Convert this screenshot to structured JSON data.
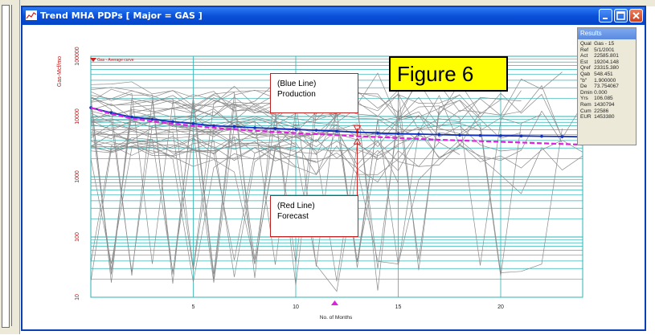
{
  "window": {
    "title": "Trend MHA PDPs  [ Major = GAS ]"
  },
  "annotations": {
    "figure_label": "Figure 6",
    "blue_callout": {
      "line1": "(Blue Line)",
      "line2": "Production"
    },
    "red_callout": {
      "line1": "(Red Line)",
      "line2": "Forecast"
    }
  },
  "results": {
    "title": "Results",
    "rows": [
      {
        "key": "Qual",
        "value": "Gas - 15"
      },
      {
        "key": "Ref",
        "value": "5/1/2001"
      },
      {
        "key": "Act",
        "value": "22585.801"
      },
      {
        "key": "Est",
        "value": "19204.148"
      },
      {
        "key": "Qref",
        "value": "23315.380"
      },
      {
        "key": "Qab",
        "value": "548.451"
      },
      {
        "key": "\"b\"",
        "value": "1.900000"
      },
      {
        "key": "De",
        "value": "73.754067"
      },
      {
        "key": "Dmin",
        "value": "0.000"
      },
      {
        "key": "Yrs",
        "value": "106.085"
      },
      {
        "key": "Rem",
        "value": "1430794"
      },
      {
        "key": "Cum",
        "value": "22586"
      },
      {
        "key": "EUR",
        "value": "1453380"
      }
    ]
  },
  "colors": {
    "grid": "#2bb3b3",
    "production": "#1030c0",
    "forecast": "#e020e0",
    "wells": "#8a8a8a",
    "axis_text": "#c01010"
  },
  "chart_data": {
    "type": "line",
    "ylabel": "Gas-Mcf/mo",
    "xlabel": "No. of Months",
    "legend": "Gas - Average curve",
    "y_scale": "log",
    "ylim": [
      10,
      100000
    ],
    "xlim": [
      0,
      24
    ],
    "y_ticks": [
      "100000",
      "10000",
      "1000",
      "100",
      "10"
    ],
    "x_ticks": [
      "5",
      "10",
      "15",
      "20"
    ],
    "grid": true,
    "series": [
      {
        "name": "Production",
        "x": [
          0,
          1,
          2,
          3,
          4,
          5,
          6,
          7,
          8,
          9,
          10,
          11,
          12,
          13,
          14,
          15,
          16,
          17,
          18,
          19,
          20,
          21,
          22,
          23,
          24
        ],
        "values": [
          14000,
          11500,
          9800,
          9000,
          8200,
          7600,
          7000,
          6800,
          6500,
          6300,
          6100,
          5900,
          5700,
          5500,
          5300,
          5200,
          5100,
          5000,
          4900,
          4850,
          4800,
          4750,
          4700,
          4650,
          4600
        ]
      },
      {
        "name": "Forecast",
        "x": [
          0,
          1,
          2,
          3,
          4,
          5,
          6,
          7,
          8,
          9,
          10,
          11,
          12,
          13,
          14,
          15,
          16,
          17,
          18,
          19,
          20,
          21,
          22,
          23,
          24
        ],
        "values": [
          14000,
          11000,
          9300,
          8300,
          7600,
          7000,
          6500,
          6100,
          5800,
          5550,
          5300,
          5100,
          4900,
          4700,
          4550,
          4400,
          4250,
          4100,
          4000,
          3900,
          3800,
          3700,
          3600,
          3500,
          3400
        ]
      }
    ]
  }
}
